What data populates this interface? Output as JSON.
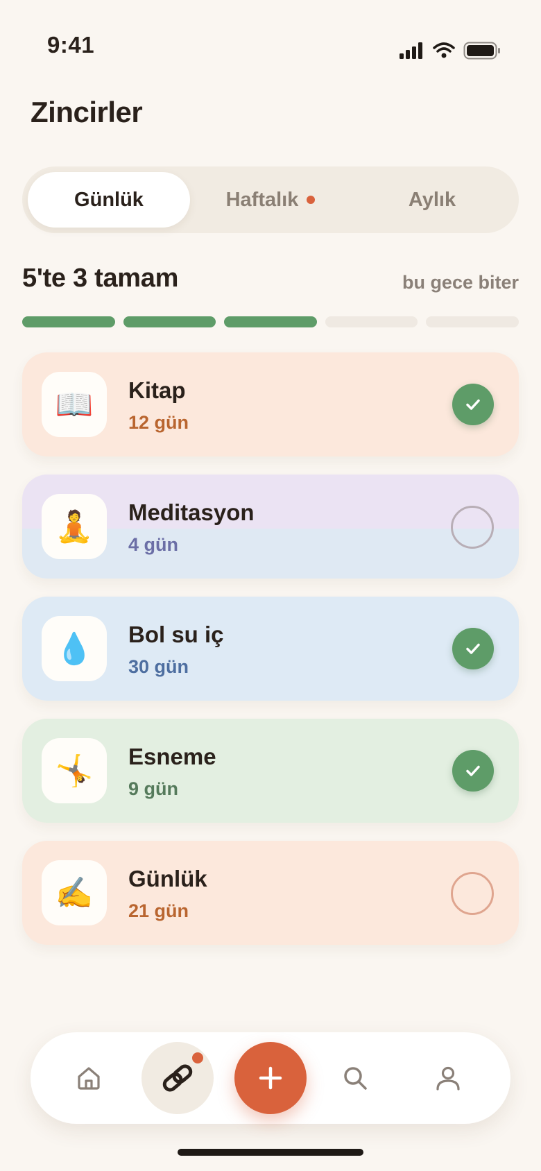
{
  "status_bar": {
    "time": "9:41"
  },
  "page_title": "Zincirler",
  "segmented": {
    "items": [
      {
        "label": "Günlük",
        "active": true,
        "badge": false
      },
      {
        "label": "Haftalık",
        "active": false,
        "badge": true
      },
      {
        "label": "Aylık",
        "active": false,
        "badge": false
      }
    ]
  },
  "progress": {
    "title": "5'te 3 tamam",
    "note": "bu gece biter",
    "done": 3,
    "total": 5
  },
  "habits": [
    {
      "name": "Kitap",
      "streak": "12 gün",
      "icon": "open-book-icon",
      "emoji": "📖",
      "done": true,
      "bg": "#fce8dc",
      "streak_color": "#b9652f"
    },
    {
      "name": "Meditasyon",
      "streak": "4 gün",
      "icon": "meditation-icon",
      "emoji": "🧘",
      "done": false,
      "bg": "#ebe3f3",
      "streak_color": "#6b6ea6"
    },
    {
      "name": "Bol su iç",
      "streak": "30 gün",
      "icon": "water-drop-icon",
      "emoji": "💧",
      "done": true,
      "bg": "#deeaf5",
      "streak_color": "#4d6ea0"
    },
    {
      "name": "Esneme",
      "streak": "9 gün",
      "icon": "stretch-icon",
      "emoji": "🤸",
      "done": true,
      "bg": "#e3efe1",
      "streak_color": "#557a5b"
    },
    {
      "name": "Günlük",
      "streak": "21 gün",
      "icon": "writing-hand-icon",
      "emoji": "✍️",
      "done": false,
      "bg": "#fce8dc",
      "streak_color": "#b9652f"
    }
  ],
  "colors": {
    "accent": "#d9623c",
    "success": "#5e9c68",
    "background": "#faf6f1"
  },
  "tabbar": [
    "home-icon",
    "chain-icon",
    "plus-icon",
    "search-icon",
    "profile-icon"
  ]
}
